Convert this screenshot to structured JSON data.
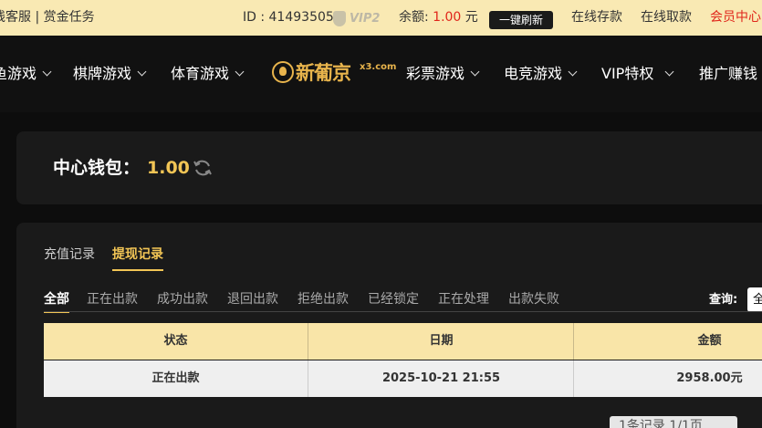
{
  "topbar": {
    "left_text": "线客服 | 赏金任务",
    "user_id": "ID : 41493505",
    "vip_level": "VIP2",
    "balance_label": "余额:",
    "balance_amount": "1.00",
    "balance_unit": "元",
    "refresh_label": "一键刷新",
    "deposit_label": "在线存款",
    "withdraw_label": "在线取款",
    "member_label": "会员中心"
  },
  "nav": {
    "items": [
      "鱼游戏",
      "棋牌游戏",
      "体育游戏",
      "彩票游戏",
      "电竞游戏",
      "VIP特权",
      "推广赚钱"
    ],
    "logo_text": "新葡京",
    "logo_sub": "x3.com"
  },
  "wallet": {
    "label": "中心钱包：",
    "value": "1.00"
  },
  "records": {
    "tabs": [
      "充值记录",
      "提现记录"
    ],
    "active_tab": "提现记录",
    "filters": [
      "全部",
      "正在出款",
      "成功出款",
      "退回出款",
      "拒绝出款",
      "已经锁定",
      "正在处理",
      "出款失败"
    ],
    "active_filter": "全部",
    "query_label": "查询:",
    "query_value": "全",
    "columns": [
      "状态",
      "日期",
      "金额"
    ],
    "rows": [
      {
        "status": "正在出款",
        "date": "2025-10-21 21:55",
        "amount": "2958.00元"
      }
    ],
    "pager": "1条记录  1/1页"
  },
  "colors": {
    "accent_gold": "#f2c555",
    "topbar_bg": "#f9e9b3",
    "alert_red": "#e0261b"
  }
}
